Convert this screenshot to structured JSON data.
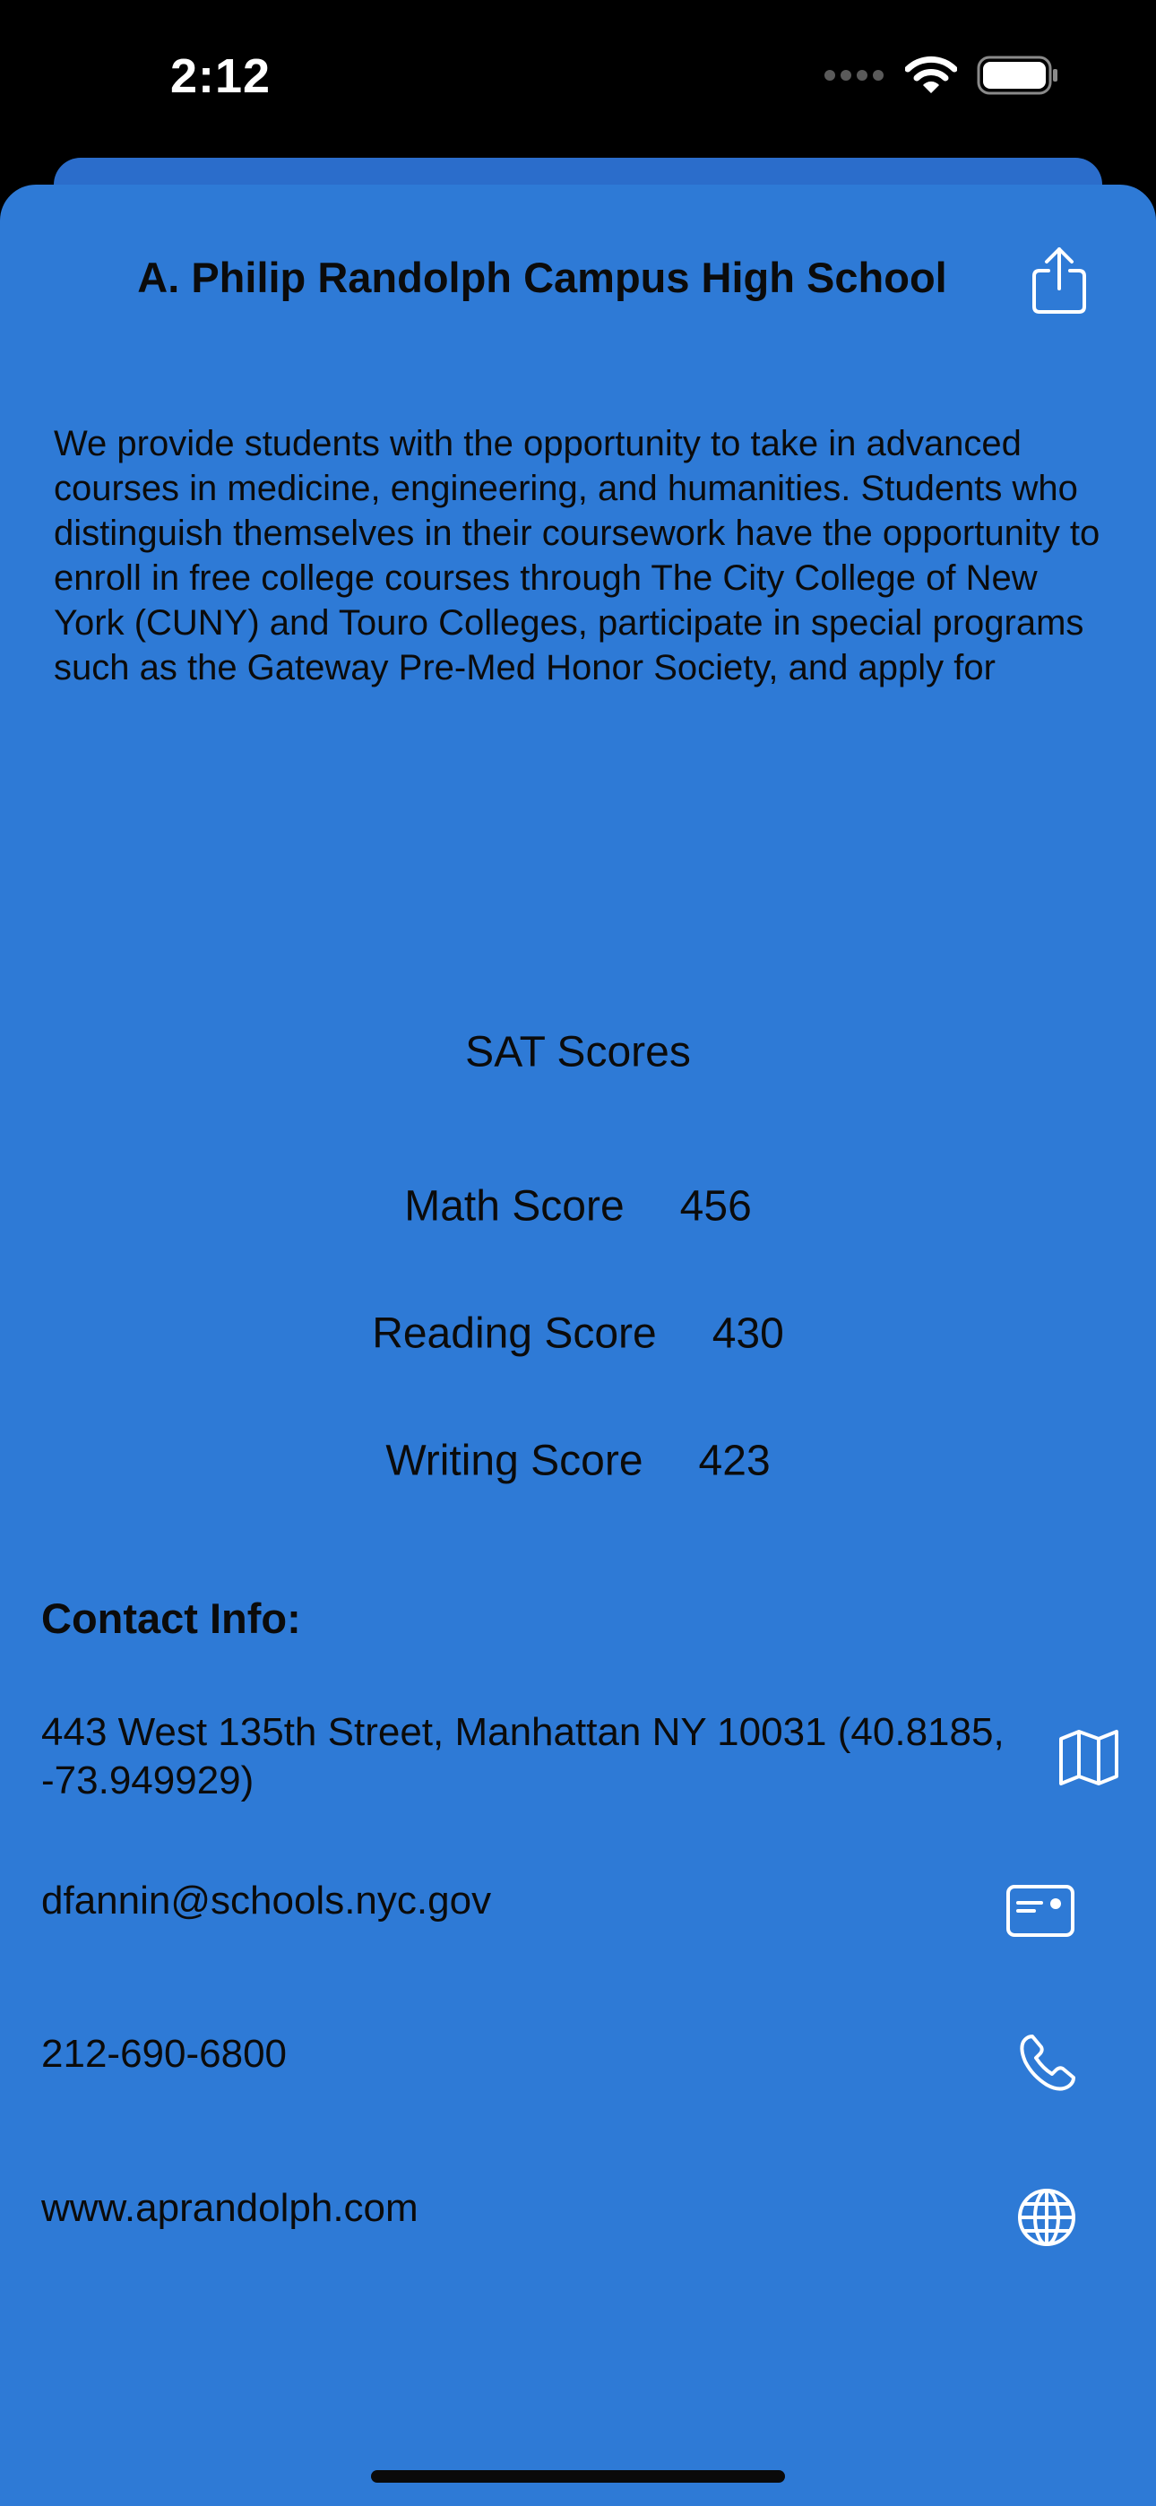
{
  "status_bar": {
    "time": "2:12"
  },
  "school": {
    "name": "A. Philip Randolph Campus High School",
    "overview": "We provide students with the opportunity to take in advanced courses in medicine, engineering, and humanities. Students who distinguish themselves in their coursework have the opportunity to enroll in free college courses through The City College of New York (CUNY) and Touro Colleges, participate in special programs such as the Gateway Pre-Med Honor Society, and apply for internships. We offer a wide range of extracurricular and athletic activities to broaden and engage our students outside of the classroom. Our after-school activities range from activities such as musical and arts productions to exciting Science, Technology, Engineering, and Mathematics (STEM)"
  },
  "sat": {
    "title": "SAT Scores",
    "math_label": "Math Score",
    "math_value": "456",
    "reading_label": "Reading Score",
    "reading_value": "430",
    "writing_label": "Writing Score",
    "writing_value": "423"
  },
  "contact": {
    "heading": "Contact Info:",
    "address": "443 West 135th Street, Manhattan NY 10031 (40.8185, -73.949929)",
    "email": "dfannin@schools.nyc.gov",
    "phone": "212-690-6800",
    "website": "www.aprandolph.com"
  },
  "icons": {
    "share": "share-icon",
    "address": "map-icon",
    "email": "email-card-icon",
    "phone": "phone-icon",
    "website": "globe-icon"
  },
  "colors": {
    "background": "#2e7ad6",
    "sheet_back": "#2b6dcb",
    "status_bar": "#000000",
    "text": "#0b0b0b",
    "icon": "#ffffff"
  }
}
